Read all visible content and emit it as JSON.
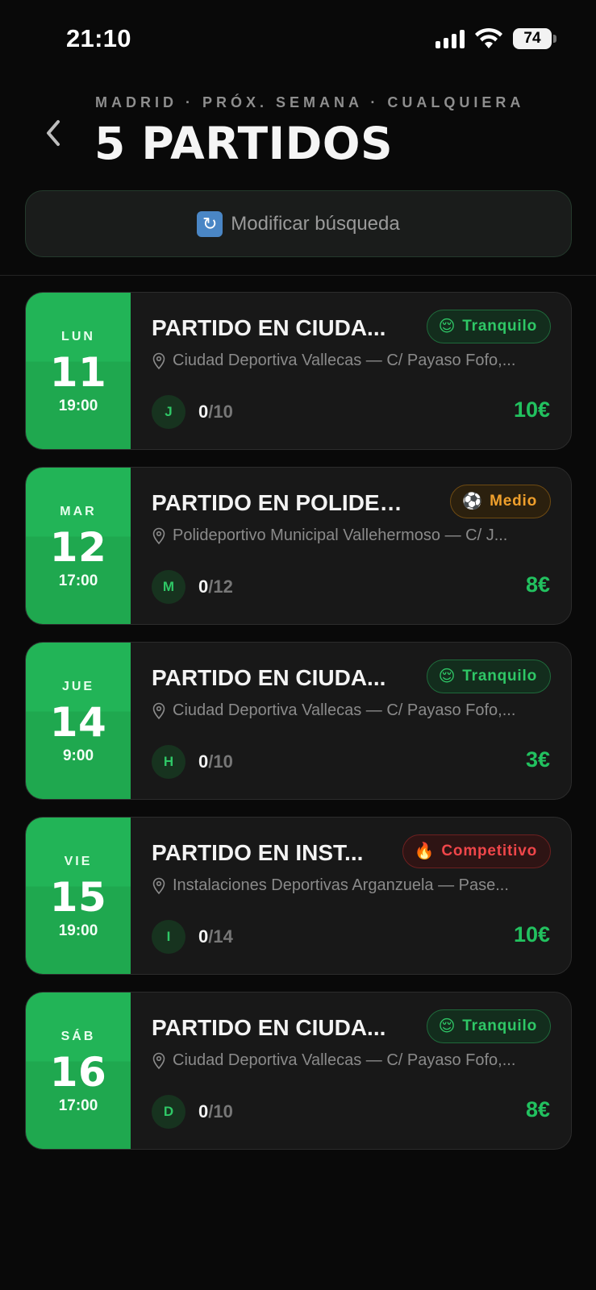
{
  "status_bar": {
    "time": "21:10",
    "battery": "74"
  },
  "header": {
    "subtitle": "MADRID · PRÓX. SEMANA · CUALQUIERA",
    "title": "5 PARTIDOS",
    "back_icon": "chevron-left-icon"
  },
  "search": {
    "modify_label": "Modificar búsqueda",
    "icon": "refresh-icon"
  },
  "colors": {
    "accent_green": "#22b457",
    "background": "#090909",
    "card": "#181818"
  },
  "matches": [
    {
      "weekday": "LUN",
      "day": "11",
      "time": "19:00",
      "title": "PARTIDO EN CIUDA...",
      "badge": "Tranquilo",
      "badge_emoji": "😌",
      "badge_type": "green",
      "location": "Ciudad Deportiva Vallecas — C/ Payaso Fofo,...",
      "avatar": "J",
      "players": "0",
      "max_players": "/10",
      "price": "10€"
    },
    {
      "weekday": "MAR",
      "day": "12",
      "time": "17:00",
      "title": "PARTIDO EN POLIDEP...",
      "badge": "Medio",
      "badge_emoji": "⚽",
      "badge_type": "orange",
      "location": "Polideportivo Municipal Vallehermoso — C/ J...",
      "avatar": "M",
      "players": "0",
      "max_players": "/12",
      "price": "8€"
    },
    {
      "weekday": "JUE",
      "day": "14",
      "time": "9:00",
      "title": "PARTIDO EN CIUDA...",
      "badge": "Tranquilo",
      "badge_emoji": "😌",
      "badge_type": "green",
      "location": "Ciudad Deportiva Vallecas — C/ Payaso Fofo,...",
      "avatar": "H",
      "players": "0",
      "max_players": "/10",
      "price": "3€"
    },
    {
      "weekday": "VIE",
      "day": "15",
      "time": "19:00",
      "title": "PARTIDO EN INST...",
      "badge": "Competitivo",
      "badge_emoji": "🔥",
      "badge_type": "red",
      "location": "Instalaciones Deportivas Arganzuela — Pase...",
      "avatar": "I",
      "players": "0",
      "max_players": "/14",
      "price": "10€"
    },
    {
      "weekday": "SÁB",
      "day": "16",
      "time": "17:00",
      "title": "PARTIDO EN CIUDA...",
      "badge": "Tranquilo",
      "badge_emoji": "😌",
      "badge_type": "green",
      "location": "Ciudad Deportiva Vallecas — C/ Payaso Fofo,...",
      "avatar": "D",
      "players": "0",
      "max_players": "/10",
      "price": "8€"
    }
  ]
}
